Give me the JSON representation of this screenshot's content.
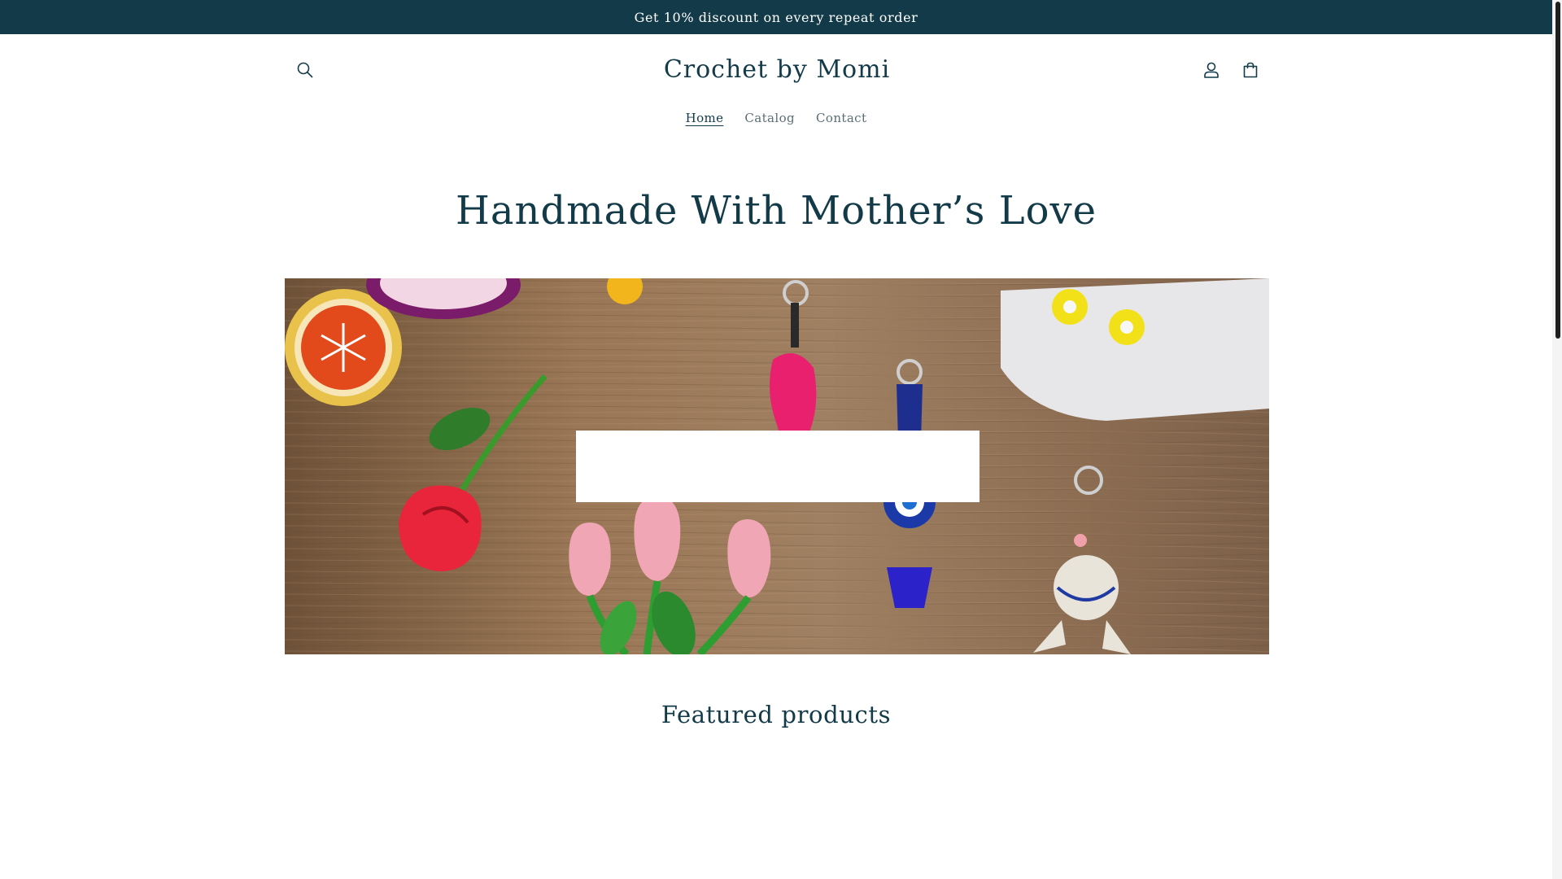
{
  "announcement": {
    "text": "Get 10% discount on every repeat order"
  },
  "header": {
    "logo": "Crochet by Momi",
    "icons": {
      "search": "search-icon",
      "account": "account-icon",
      "cart": "cart-icon"
    }
  },
  "nav": {
    "items": [
      {
        "label": "Home",
        "active": true
      },
      {
        "label": "Catalog",
        "active": false
      },
      {
        "label": "Contact",
        "active": false
      }
    ]
  },
  "hero": {
    "title": "Handmade With Mother’s Love"
  },
  "featured": {
    "title": "Featured products"
  },
  "colors": {
    "primary": "#123a48",
    "background": "#ffffff",
    "wood": "#8a6a4b"
  }
}
